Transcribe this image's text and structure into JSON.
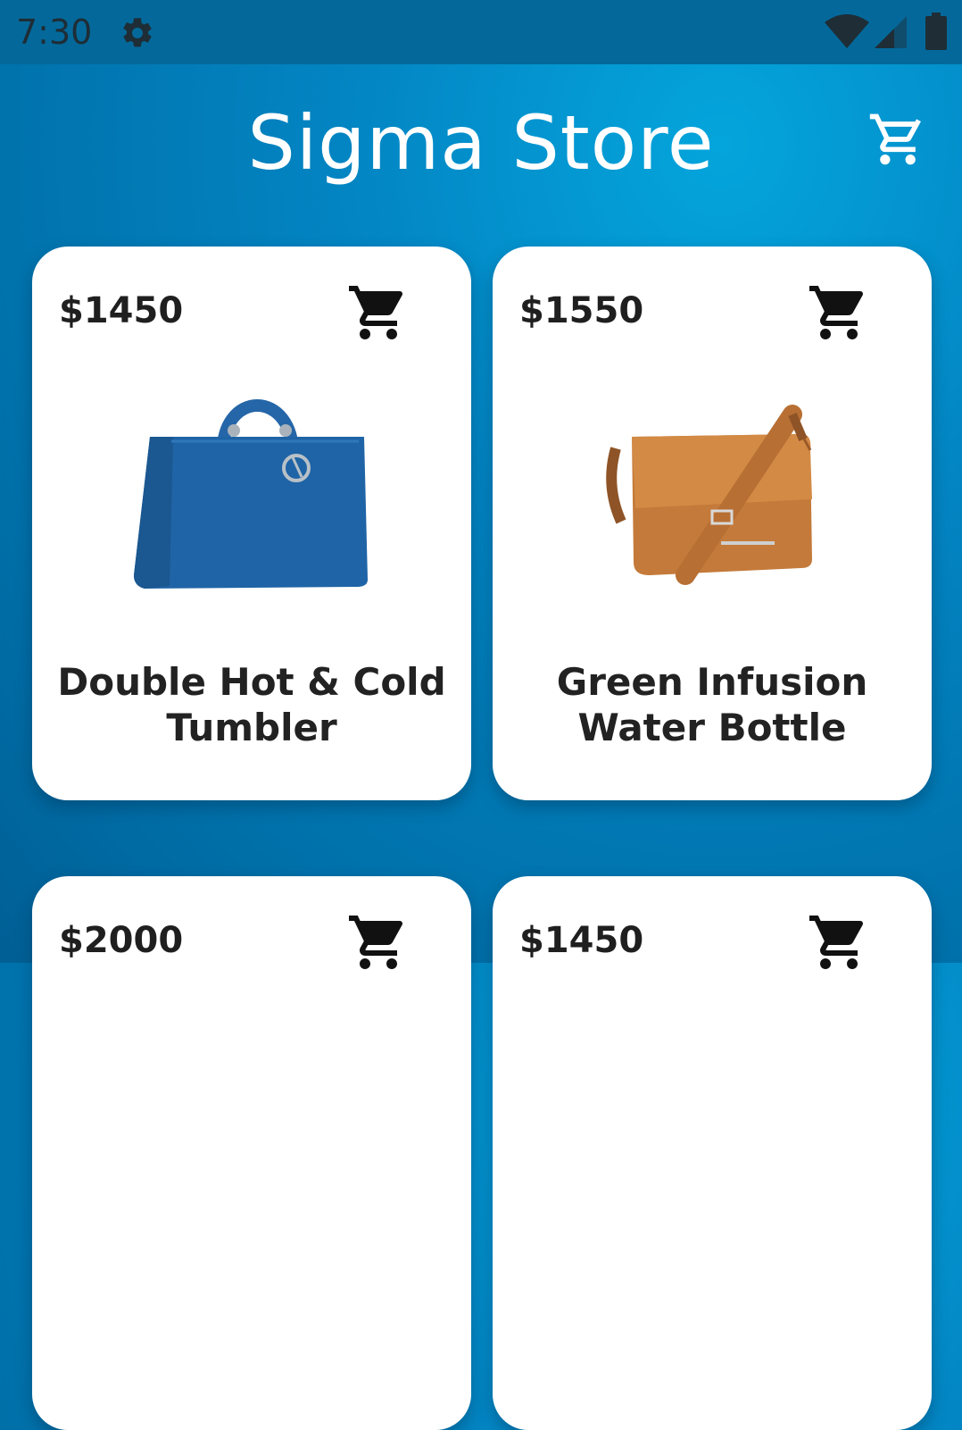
{
  "status": {
    "time": "7:30"
  },
  "header": {
    "title": "Sigma Store"
  },
  "products": [
    {
      "price": "$1450",
      "name": "Double Hot & Cold Tumbler",
      "image": "blue-handbag"
    },
    {
      "price": "$1550",
      "name": "Green Infusion Water Bottle",
      "image": "brown-satchel"
    },
    {
      "price": "$2000",
      "name": "",
      "image": ""
    },
    {
      "price": "$1450",
      "name": "",
      "image": ""
    }
  ],
  "colors": {
    "bg": "#0386c4",
    "statusbar": "#04699a",
    "card": "#ffffff"
  }
}
